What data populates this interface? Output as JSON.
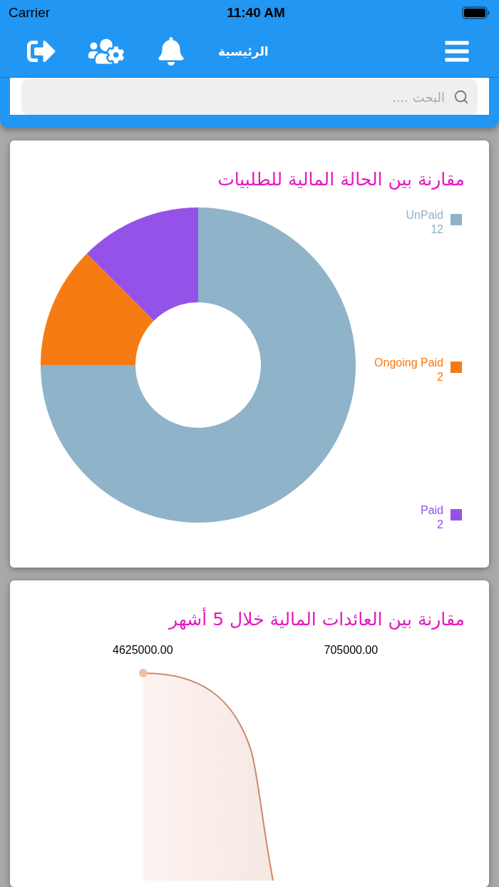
{
  "status_bar": {
    "carrier": "Carrier",
    "time": "11:40 AM"
  },
  "nav_bar": {
    "title": "الرئيسية"
  },
  "search": {
    "placeholder": "البحث ...."
  },
  "payment_status_card": {
    "title": "مقارنة بين الحالة المالية للطلبيات",
    "chart_data": {
      "type": "donut",
      "categories": [
        "UnPaid",
        "Ongoing Paid",
        "Paid"
      ],
      "values": [
        75,
        12.5,
        12.5
      ]
    },
    "legend": [
      {
        "value": "12",
        "color": "#8fb3c9"
      },
      {
        "value": "2",
        "color": "#f77b13"
      },
      {
        "value": "2",
        "color": "#9552e8"
      }
    ]
  },
  "revenue_card": {
    "title": "مقارنة بين العائدات المالية خلال 5 أشهر",
    "value_labels": [
      "705000.00",
      "4625000.00"
    ]
  }
}
